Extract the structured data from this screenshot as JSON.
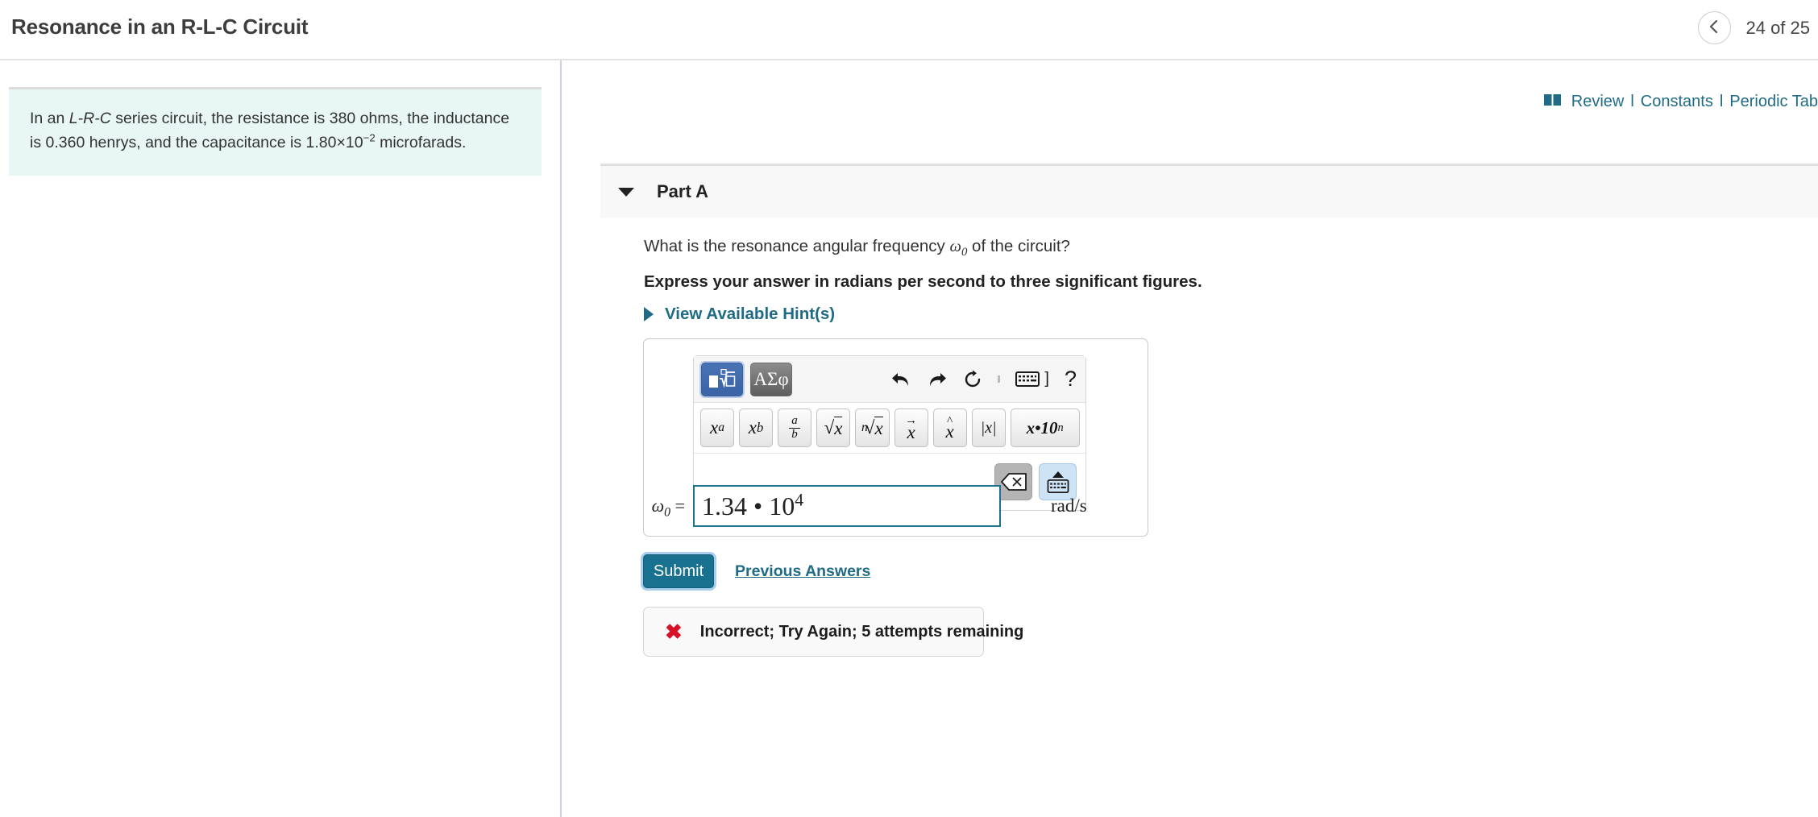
{
  "header": {
    "title": "Resonance in an R-L-C Circuit",
    "prev_icon": "chevron-left-icon",
    "pager_label": "24 of 25"
  },
  "resources": {
    "book_icon": "book-icon",
    "review": "Review",
    "separator": "l",
    "constants": "Constants",
    "periodic_table": "Periodic Tab"
  },
  "problem": {
    "text_part1": "In an ",
    "text_italic": "L-R-C",
    "text_part2": " series circuit, the resistance is 380 ohms, the inductance is 0.360 henrys, and the capacitance is 1.80×10",
    "exponent": "−2",
    "text_part3": " microfarads."
  },
  "part": {
    "toggle_icon": "caret-down-icon",
    "title": "Part A",
    "question_part1": "What is the resonance angular frequency ",
    "question_var": "ω",
    "question_var_sub": "0",
    "question_part2": " of the circuit?",
    "instruction": "Express your answer in radians per second to three significant figures.",
    "hints_icon": "caret-right-icon",
    "hints_label": "View Available Hint(s)"
  },
  "math_toolbar": {
    "mode_math_icon": "math-palette-icon",
    "mode_greek_label": "ΑΣφ",
    "undo_icon": "undo-arrow-icon",
    "redo_icon": "redo-arrow-icon",
    "reset_icon": "reset-circular-arrow-icon",
    "keyboard_icon": "keyboard-icon",
    "bracket_icon": "]",
    "help_icon": "?",
    "symbols": [
      {
        "name": "superscript-button",
        "label": "x",
        "sup": "a"
      },
      {
        "name": "subscript-button",
        "label": "x",
        "sub": "b"
      },
      {
        "name": "fraction-button",
        "num": "a",
        "den": "b"
      },
      {
        "name": "square-root-button",
        "radicand": "x"
      },
      {
        "name": "nth-root-button",
        "index": "n",
        "radicand": "x"
      },
      {
        "name": "vector-button",
        "label": "x"
      },
      {
        "name": "hat-button",
        "label": "x"
      },
      {
        "name": "absolute-value-button",
        "label": "|x|"
      },
      {
        "name": "scientific-notation-button",
        "label": "x•10",
        "sup": "n"
      }
    ],
    "backspace_icon": "backspace-icon",
    "keyboard_toggle_icon": "keyboard-up-icon"
  },
  "answer": {
    "variable": "ω",
    "variable_sub": "0",
    "equals": "=",
    "value": "1.34 • 10",
    "value_exponent": "4",
    "units": "rad/s"
  },
  "actions": {
    "submit_label": "Submit",
    "previous_answers_label": "Previous Answers"
  },
  "feedback": {
    "icon": "red-x-icon",
    "icon_glyph": "✖",
    "message": "Incorrect; Try Again; 5 attempts remaining"
  },
  "colors": {
    "accent_teal": "#1f6b86",
    "submit_bg": "#17718f",
    "problem_bg": "#e8f6f5",
    "error_red": "#d81028",
    "input_border": "#1c7391"
  }
}
